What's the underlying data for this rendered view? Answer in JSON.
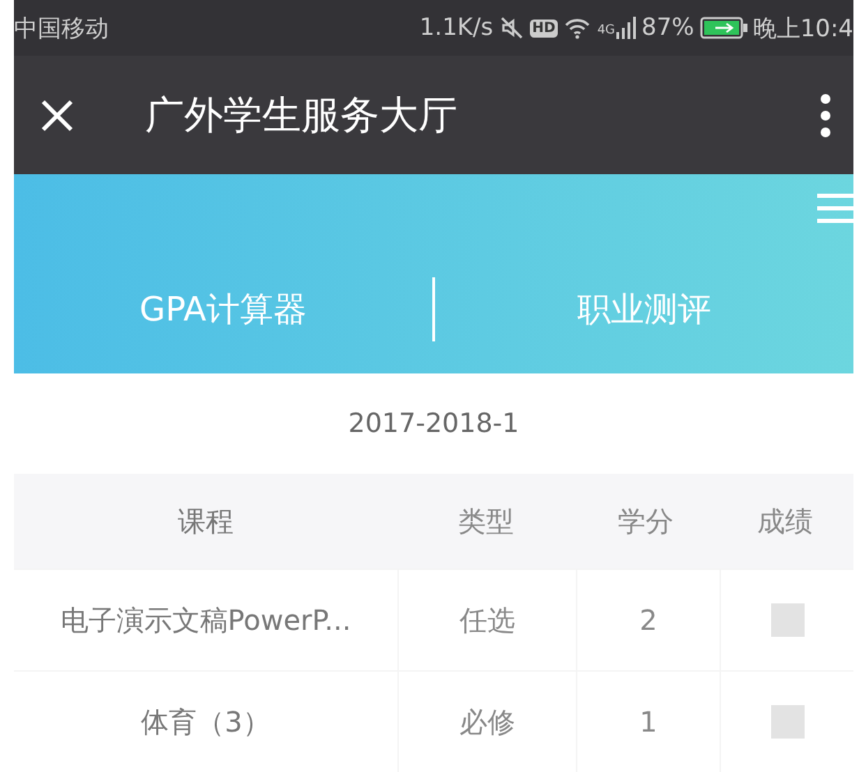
{
  "status_bar": {
    "carrier": "中国移动",
    "speed": "1.1K/s",
    "hd": "HD",
    "network": "4G",
    "battery": "87%",
    "time": "晚上10:4"
  },
  "title_bar": {
    "title": "广外学生服务大厅"
  },
  "tabs": [
    {
      "label": "GPA计算器"
    },
    {
      "label": "职业测评"
    }
  ],
  "semester": "2017-2018-1",
  "table": {
    "columns": [
      "课程",
      "类型",
      "学分",
      "成绩"
    ],
    "rows": [
      {
        "course": "电子演示文稿PowerP...",
        "type": "任选",
        "credit": "2"
      },
      {
        "course": "体育（3）",
        "type": "必修",
        "credit": "1"
      }
    ]
  }
}
